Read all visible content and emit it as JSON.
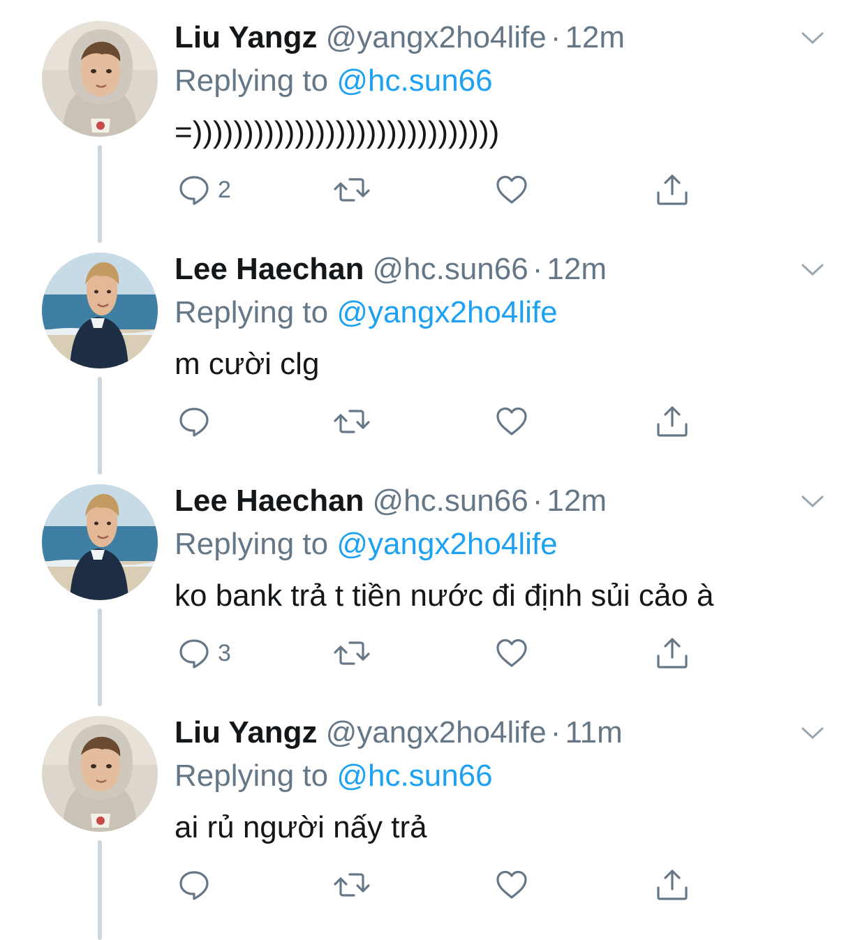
{
  "tweets": [
    {
      "name": "Liu Yangz",
      "handle": "@yangx2ho4life",
      "dot": "·",
      "time": "12m",
      "replying_prefix": "Replying to",
      "replying_to": "@hc.sun66",
      "text": "=))))))))))))))))))))))))))))))",
      "reply_count": "2",
      "avatar": "hoodie-portrait"
    },
    {
      "name": "Lee Haechan",
      "handle": "@hc.sun66",
      "dot": "·",
      "time": "12m",
      "replying_prefix": "Replying to",
      "replying_to": "@yangx2ho4life",
      "text": "m cười clg",
      "reply_count": "",
      "avatar": "beach-portrait"
    },
    {
      "name": "Lee Haechan",
      "handle": "@hc.sun66",
      "dot": "·",
      "time": "12m",
      "replying_prefix": "Replying to",
      "replying_to": "@yangx2ho4life",
      "text": "ko bank trả t tiền nước đi định sủi cảo à",
      "reply_count": "3",
      "avatar": "beach-portrait"
    },
    {
      "name": "Liu Yangz",
      "handle": "@yangx2ho4life",
      "dot": "·",
      "time": "11m",
      "replying_prefix": "Replying to",
      "replying_to": "@hc.sun66",
      "text": "ai rủ người nấy trả",
      "reply_count": "",
      "avatar": "hoodie-portrait"
    }
  ],
  "icons": {
    "reply": "reply-bubble-icon",
    "retweet": "retweet-icon",
    "like": "heart-icon",
    "share": "share-icon",
    "menu": "chevron-down-icon"
  },
  "colors": {
    "name": "#14171a",
    "muted": "#657786",
    "mention": "#1da1f2",
    "thread_line": "#ccd6dd",
    "icon": "#657786"
  }
}
